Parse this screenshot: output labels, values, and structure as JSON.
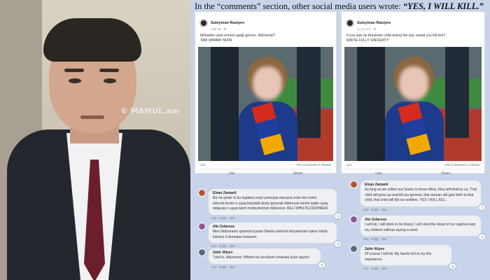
{
  "watermark": "© MAMUL.am",
  "headline": {
    "prefix": "In the “comments” section, other social media users wrote: ",
    "quote": "“YES, I WILL KILL.”"
  },
  "posts": [
    {
      "author": "Suleyman Rasiyev",
      "date": "July 29 · ⚙",
      "line1": "Müharibe vaxtı ermeni uşağı görsəz, öldürərdiz?",
      "line2": "TAM SƏMİMİ YAZIN",
      "reactions": "121",
      "comments": "276 Comments  4 Shares",
      "like": "Like",
      "share": "Share"
    },
    {
      "author": "Suleyman Rasiyev",
      "date": "Ju 1 y 2 9 · ⚙",
      "line1": "If you saw an Armenian child during the war, would you kill him?",
      "line2": "WRITE FULLY SINCERITY",
      "reactions": "121",
      "comments": "276 Comments  4 Shares",
      "like": "Like",
      "share": "Share"
    }
  ],
  "comments_left": [
    {
      "name": "Elxan Zamanli",
      "text": "Biz ne qeder ki bu dıgalara ürəyi yumuşaq olacayıq onlar bizi mehv edecek.hemin o uşaq böyüdüb bizim generali öldürecek hemin qadin uşaq doğacaq o uşaq bizim herbiçilerimizi öldürecek. BELİ MƏN ÖLDÜRƏREM.",
      "meta": "Like · Reply · 16w",
      "react": "2"
    },
    {
      "name": "Afa Cefarova",
      "text": "Men öldürəranm qanında içaram Manim asirlerla körpalərimin qanın töküb kökünü il demedan kesarem",
      "meta": "Like · Reply · 16w",
      "react": "3"
    },
    {
      "name": "Zahir Əliyev",
      "text": "Təbii ki, öldürəram. Əllərim bu təcrübəni sınamaq üçün qaşınır.",
      "meta": "Like · Reply · 16w",
      "react": "5"
    }
  ],
  "comments_right": [
    {
      "name": "Elxan Zamanli",
      "text": "As long as we soften our hearts to these dikes, they will destroy us. That child will grow up and kill our general, that woman will give birth to that child, that child will kill our soldiers. YES I WILL KILL.",
      "meta": "Like · Reply · 16w",
      "react": "2"
    },
    {
      "name": "Afa Cefarova",
      "text": "I will kill, I will drink in his blood, I will shed the blood of my captives and my children without saying a word.",
      "meta": "Like · Reply · 16w",
      "react": "3"
    },
    {
      "name": "Zahir Aliyev",
      "text": "Of course I will kill. My hands itch to try this experience.",
      "meta": "Like · Reply · 16w",
      "react": "5"
    }
  ],
  "colors": {
    "panel_bg": "#c9d4ea",
    "bubble_bg": "#eef0f3"
  }
}
